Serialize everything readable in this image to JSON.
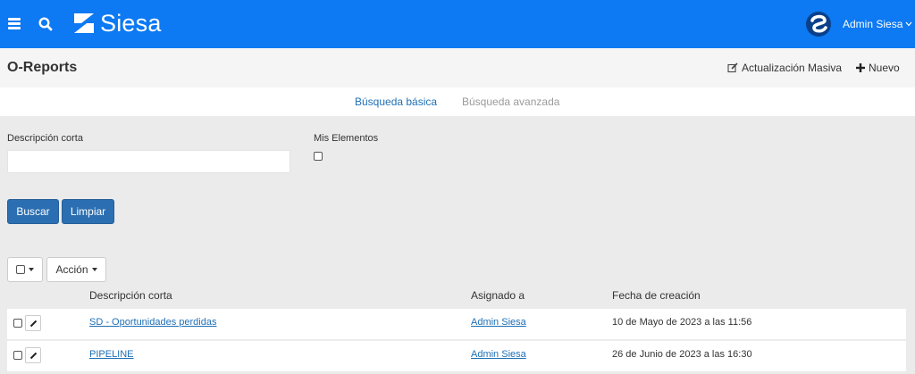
{
  "header": {
    "brand": "Siesa",
    "user_name": "Admin Siesa",
    "brand_color": "#0d79f2"
  },
  "titlebar": {
    "title": "O-Reports",
    "mass_update_label": "Actualización Masiva",
    "new_label": "Nuevo"
  },
  "tabs": [
    {
      "label": "Búsqueda básica",
      "active": true
    },
    {
      "label": "Búsqueda avanzada",
      "active": false
    }
  ],
  "search": {
    "short_desc_label": "Descripción corta",
    "short_desc_value": "",
    "my_items_label": "Mis Elementos",
    "my_items_checked": false,
    "search_button": "Buscar",
    "clear_button": "Limpiar"
  },
  "list": {
    "action_button": "Acción",
    "columns": [
      "Descripción corta",
      "Asignado a",
      "Fecha de creación"
    ],
    "rows": [
      {
        "description": "SD - Oportunidades perdidas",
        "assigned_to": "Admin Siesa",
        "created": "10 de Mayo de 2023 a las 11:56"
      },
      {
        "description": "PIPELINE",
        "assigned_to": "Admin Siesa",
        "created": "26 de Junio de 2023 a las 16:30"
      }
    ]
  }
}
